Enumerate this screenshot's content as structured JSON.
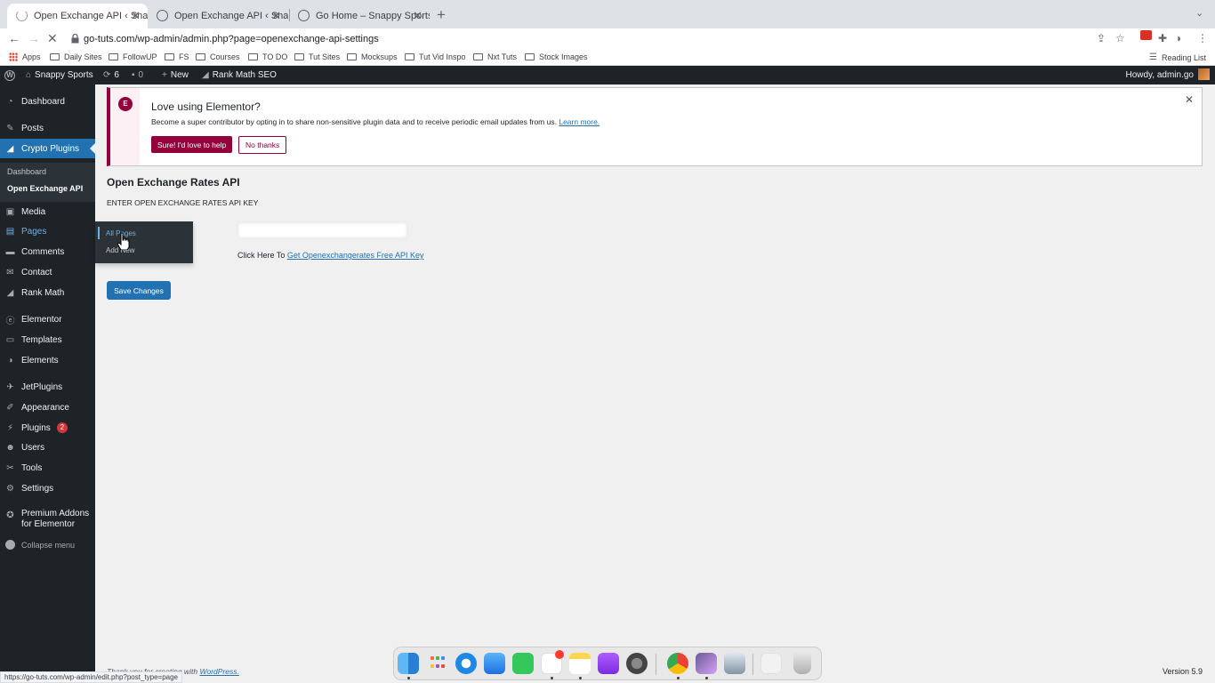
{
  "browser": {
    "tabs": [
      {
        "title": "Open Exchange API ‹ Snappy S",
        "active": true
      },
      {
        "title": "Open Exchange API ‹ Snappy S",
        "active": false
      },
      {
        "title": "Go Home – Snappy Sports",
        "active": false
      }
    ],
    "url": "go-tuts.com/wp-admin/admin.php?page=openexchange-api-settings",
    "bookmarks": [
      "Apps",
      "Daily Sites",
      "FollowUP",
      "FS",
      "Courses",
      "TO DO",
      "Tut Sites",
      "Mocksups",
      "Tut Vid Inspo",
      "Nxt Tuts",
      "Stock Images"
    ],
    "reading_list": "Reading List",
    "status_url": "https://go-tuts.com/wp-admin/edit.php?post_type=page"
  },
  "admin_bar": {
    "site_name": "Snappy Sports",
    "updates_count": "6",
    "comments_count": "0",
    "new_label": "New",
    "rank_math": "Rank Math SEO",
    "howdy": "Howdy, admin.go"
  },
  "sidebar": {
    "items": [
      {
        "label": "Dashboard",
        "icon": "dashboard-icon"
      },
      {
        "label": "Posts",
        "icon": "pin-icon"
      },
      {
        "label": "Crypto Plugins",
        "icon": "chart-icon"
      },
      {
        "label": "Media",
        "icon": "media-icon"
      },
      {
        "label": "Pages",
        "icon": "pages-icon"
      },
      {
        "label": "Comments",
        "icon": "comment-icon"
      },
      {
        "label": "Contact",
        "icon": "mail-icon"
      },
      {
        "label": "Rank Math",
        "icon": "rank-math-icon"
      },
      {
        "label": "Elementor",
        "icon": "elementor-icon"
      },
      {
        "label": "Templates",
        "icon": "folder-icon"
      },
      {
        "label": "Elements",
        "icon": "elements-icon"
      },
      {
        "label": "JetPlugins",
        "icon": "jet-icon"
      },
      {
        "label": "Appearance",
        "icon": "brush-icon"
      },
      {
        "label": "Plugins",
        "icon": "plugin-icon",
        "badge": "2"
      },
      {
        "label": "Users",
        "icon": "user-icon"
      },
      {
        "label": "Tools",
        "icon": "wrench-icon"
      },
      {
        "label": "Settings",
        "icon": "settings-icon"
      },
      {
        "label": "Premium Addons for Elementor",
        "icon": "premium-addons-icon"
      }
    ],
    "submenu": [
      "Dashboard",
      "Open Exchange API"
    ],
    "collapse": "Collapse menu",
    "flyout": [
      "All Pages",
      "Add New"
    ]
  },
  "notice": {
    "title": "Love using Elementor?",
    "text": "Become a super contributor by opting in to share non-sensitive plugin data and to receive periodic email updates from us.",
    "link": "Learn more.",
    "accept": "Sure! I'd love to help",
    "decline": "No thanks"
  },
  "main": {
    "title": "Open Exchange Rates API",
    "field_label": "ENTER OPEN EXCHANGE RATES API KEY",
    "api_key_value": "",
    "click_here": "Click Here To",
    "free_key_link": "Get Openexchangerates Free API Key",
    "save": "Save Changes"
  },
  "footer": {
    "thanks": "Thank you for creating with",
    "wordpress": "WordPress.",
    "version": "Version 5.9"
  },
  "colors": {
    "wp_dark": "#1d2327",
    "wp_blue": "#2271b1",
    "elementor": "#93003c"
  }
}
